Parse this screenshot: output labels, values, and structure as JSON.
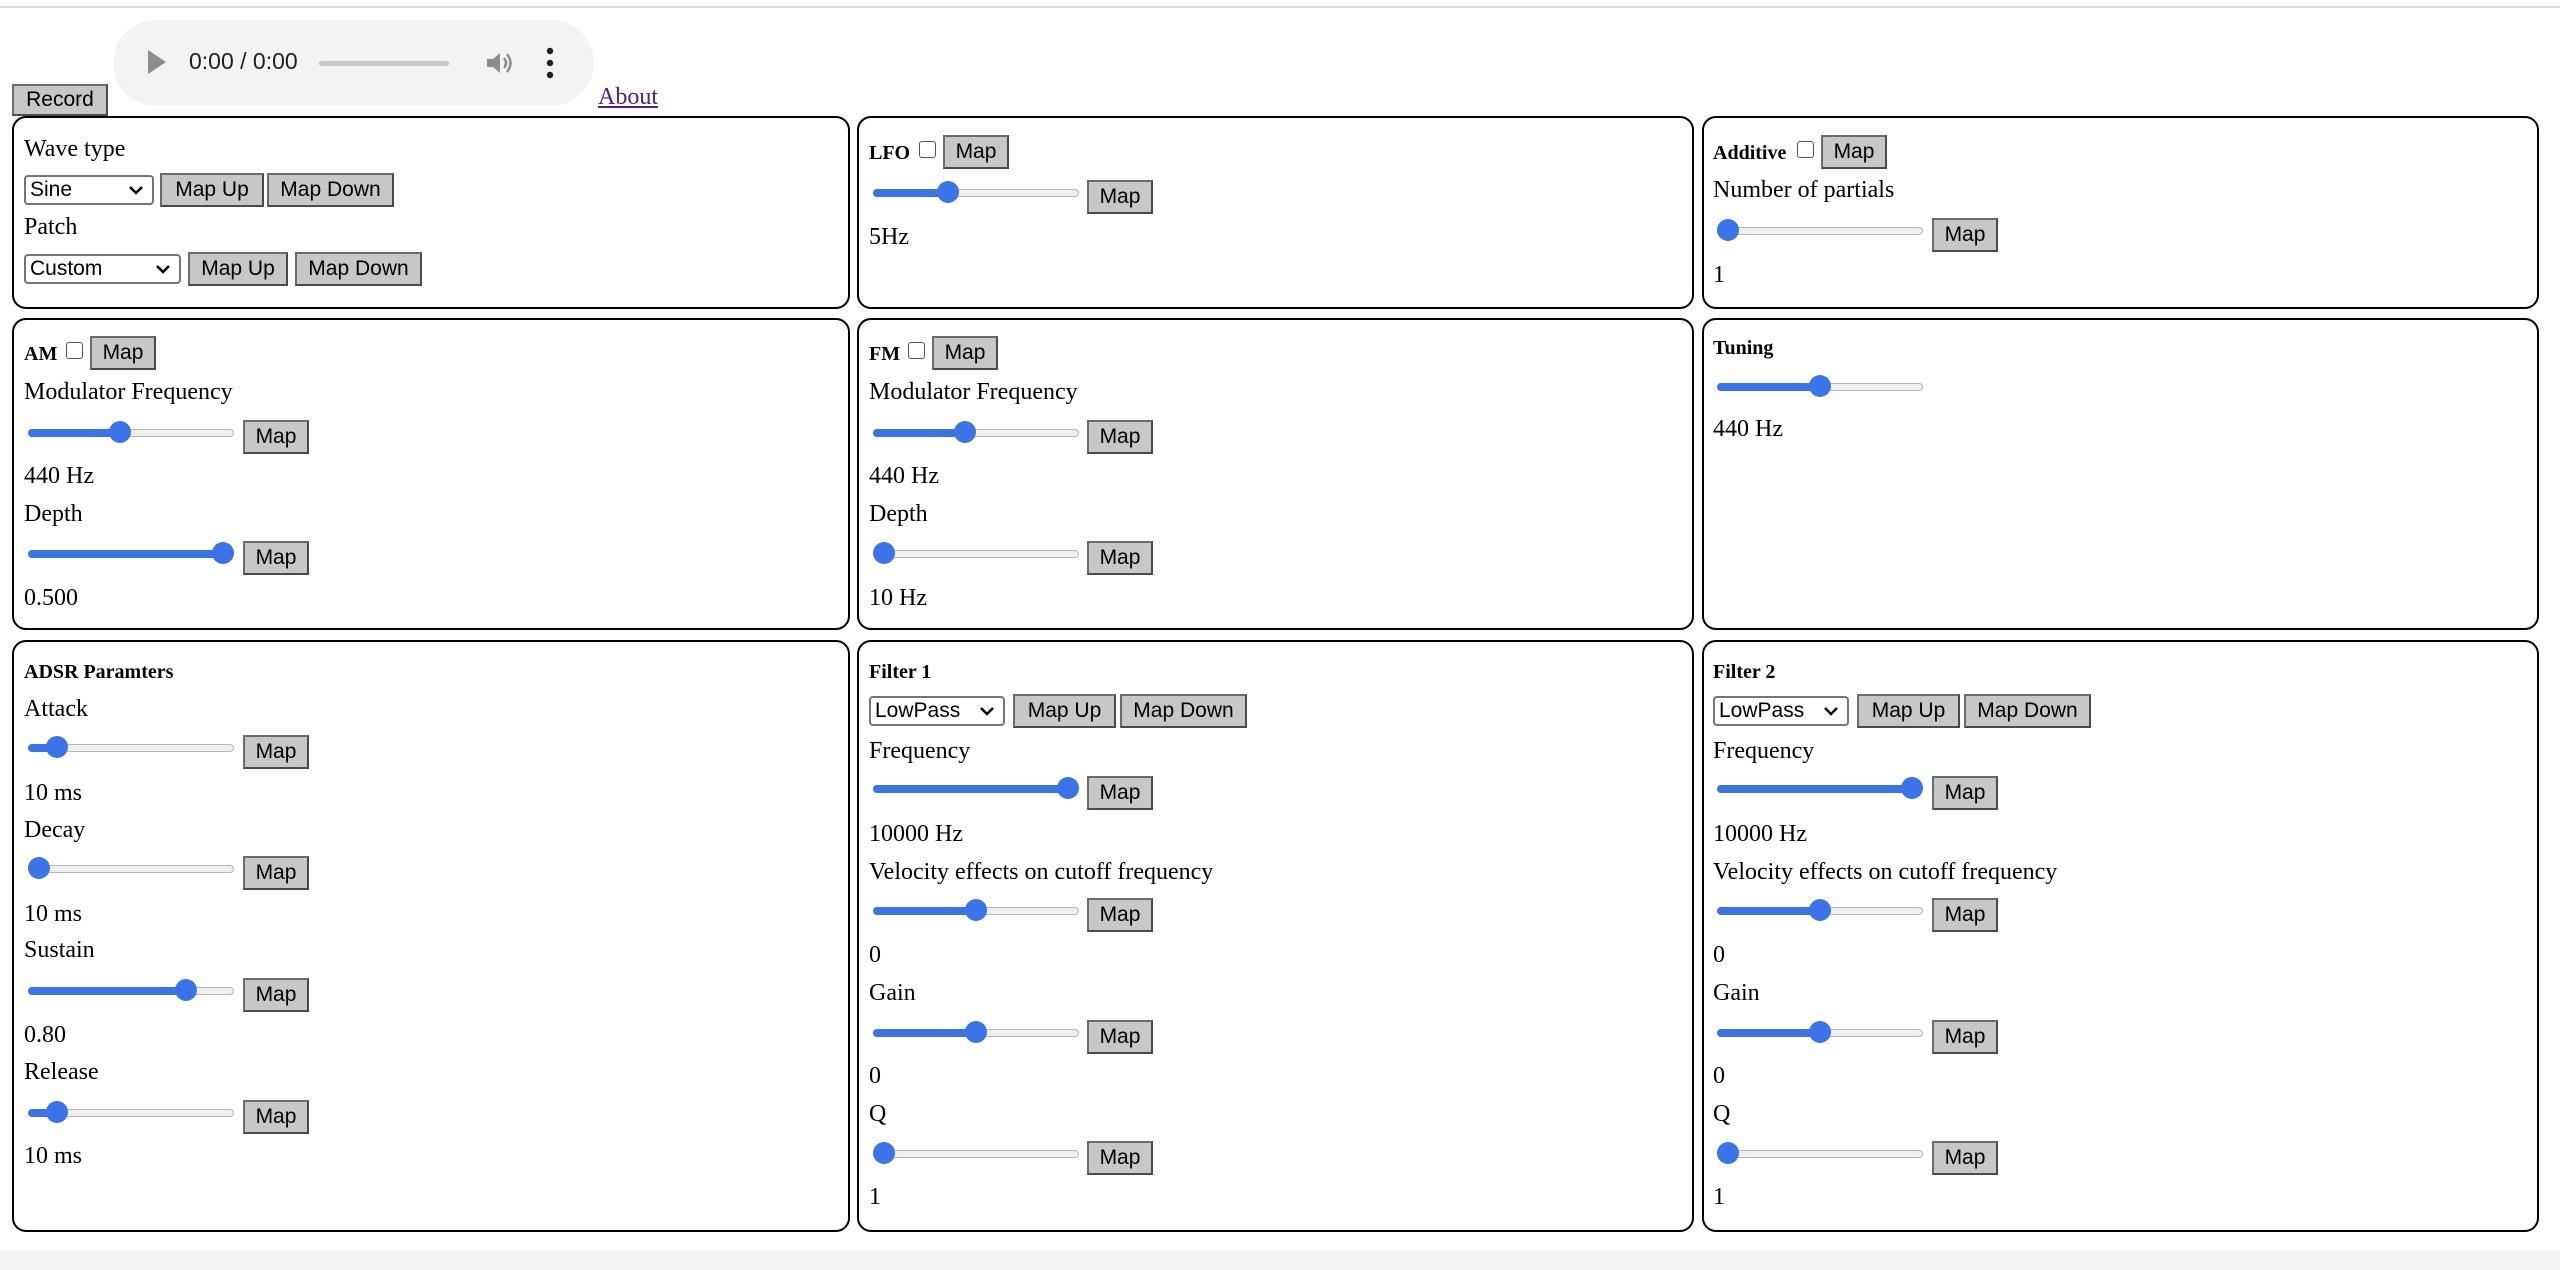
{
  "audio": {
    "time": "0:00 / 0:00",
    "progress": 0
  },
  "toolbar": {
    "record_label": "Record",
    "about_label": "About"
  },
  "common": {
    "map": "Map",
    "map_up": "Map Up",
    "map_down": "Map Down"
  },
  "waveform": {
    "wave_type_label": "Wave type",
    "wave_type_value": "Sine",
    "patch_label": "Patch",
    "patch_value": "Custom"
  },
  "lfo": {
    "title": "LFO",
    "checked": false,
    "slider": 0.35,
    "value": "5Hz"
  },
  "additive": {
    "title": "Additive",
    "checked": false,
    "partials_label": "Number of partials",
    "slider": 0.0,
    "value": "1"
  },
  "am": {
    "title": "AM",
    "checked": false,
    "freq_label": "Modulator Frequency",
    "freq_slider": 0.44,
    "freq_value": "440 Hz",
    "depth_label": "Depth",
    "depth_slider": 1.0,
    "depth_value": "0.500"
  },
  "fm": {
    "title": "FM",
    "checked": false,
    "freq_label": "Modulator Frequency",
    "freq_slider": 0.44,
    "freq_value": "440 Hz",
    "depth_label": "Depth",
    "depth_slider": 0.0,
    "depth_value": "10 Hz"
  },
  "tuning": {
    "title": "Tuning",
    "slider": 0.5,
    "value": "440 Hz"
  },
  "adsr": {
    "title": "ADSR Paramters",
    "attack_label": "Attack",
    "attack_slider": 0.1,
    "attack_value": "10 ms",
    "decay_label": "Decay",
    "decay_slider": 0.0,
    "decay_value": "10 ms",
    "sustain_label": "Sustain",
    "sustain_slider": 0.8,
    "sustain_value": "0.80",
    "release_label": "Release",
    "release_slider": 0.1,
    "release_value": "10 ms"
  },
  "filter1": {
    "title": "Filter 1",
    "type_value": "LowPass",
    "freq_label": "Frequency",
    "freq_slider": 1.0,
    "freq_value": "10000 Hz",
    "vel_label": "Velocity effects on cutoff frequency",
    "vel_slider": 0.5,
    "vel_value": "0",
    "gain_label": "Gain",
    "gain_slider": 0.5,
    "gain_value": "0",
    "q_label": "Q",
    "q_slider": 0.0,
    "q_value": "1"
  },
  "filter2": {
    "title": "Filter 2",
    "type_value": "LowPass",
    "freq_label": "Frequency",
    "freq_slider": 1.0,
    "freq_value": "10000 Hz",
    "vel_label": "Velocity effects on cutoff frequency",
    "vel_slider": 0.5,
    "vel_value": "0",
    "gain_label": "Gain",
    "gain_slider": 0.5,
    "gain_value": "0",
    "q_label": "Q",
    "q_slider": 0.0,
    "q_value": "1"
  }
}
